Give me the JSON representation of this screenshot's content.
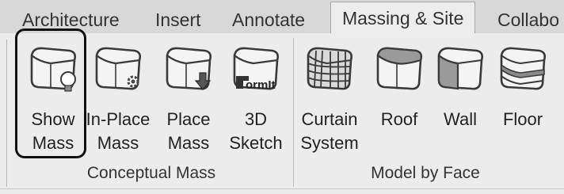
{
  "tabs": [
    {
      "id": "architecture",
      "label": "Architecture",
      "active": false
    },
    {
      "id": "insert",
      "label": "Insert",
      "active": false
    },
    {
      "id": "annotate",
      "label": "Annotate",
      "active": false
    },
    {
      "id": "massing",
      "label": "Massing & Site",
      "active": true
    },
    {
      "id": "collaborate",
      "label": "Collabo",
      "active": false
    }
  ],
  "panels": {
    "conceptual_mass": {
      "title": "Conceptual Mass",
      "tools": [
        {
          "id": "show-mass",
          "line1": "Show",
          "line2": "Mass",
          "icon": "mass-bulb-icon",
          "highlighted": true
        },
        {
          "id": "in-place-mass",
          "line1": "In-Place",
          "line2": "Mass",
          "icon": "mass-gear-icon"
        },
        {
          "id": "place-mass",
          "line1": "Place",
          "line2": "Mass",
          "icon": "mass-down-arrow-icon"
        },
        {
          "id": "3d-sketch",
          "line1": "3D",
          "line2": "Sketch",
          "icon": "formit-icon",
          "badge": "ormIt"
        }
      ]
    },
    "model_by_face": {
      "title": "Model by Face",
      "tools": [
        {
          "id": "curtain-system",
          "line1": "Curtain",
          "line2": "System",
          "icon": "curtain-grid-icon"
        },
        {
          "id": "roof",
          "line1": "Roof",
          "line2": "",
          "icon": "roof-face-icon"
        },
        {
          "id": "wall",
          "line1": "Wall",
          "line2": "",
          "icon": "wall-face-icon"
        },
        {
          "id": "floor",
          "line1": "Floor",
          "line2": "",
          "icon": "floor-face-icon"
        }
      ]
    }
  },
  "colors": {
    "ribbon_bg": "#ececec",
    "tabbar_bg": "#d8d8d8",
    "highlight_border": "#111111"
  }
}
